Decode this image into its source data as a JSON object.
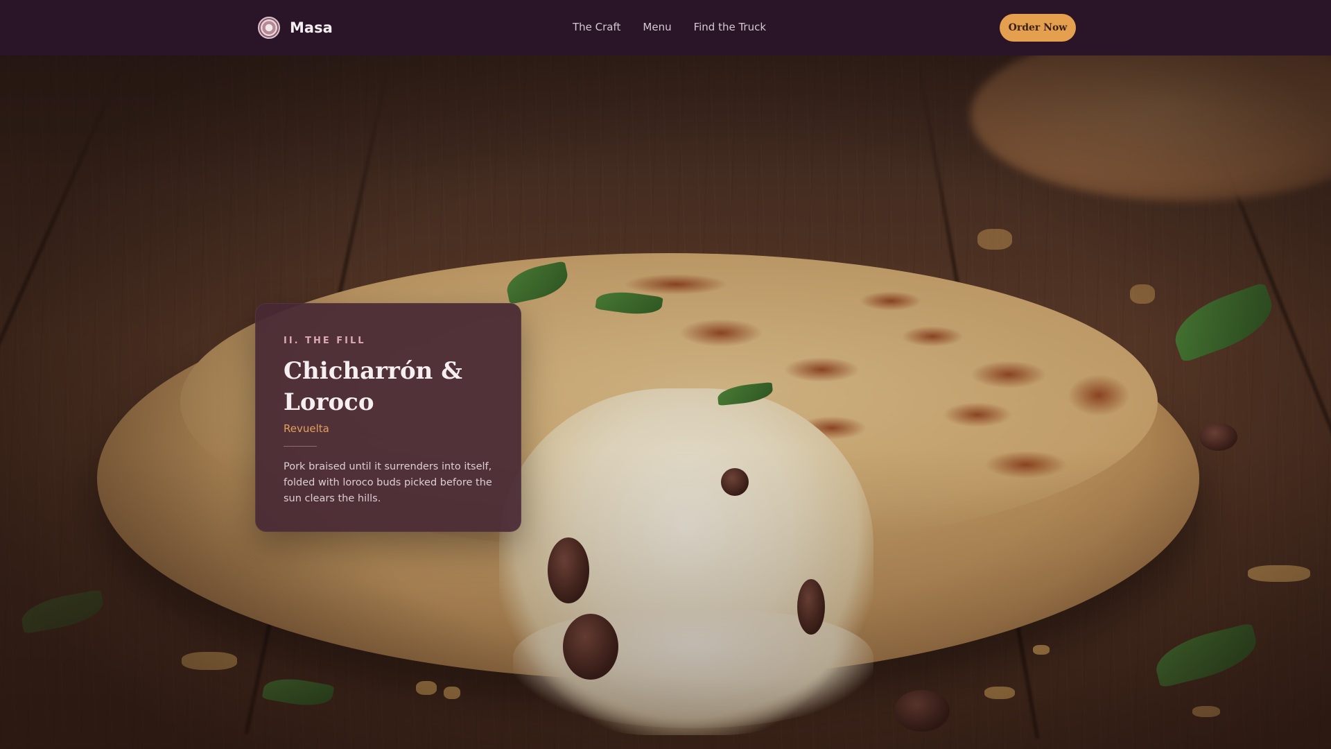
{
  "nav": {
    "brand": "Masa",
    "links": [
      "The Craft",
      "Menu",
      "Find the Truck"
    ],
    "cta": "Order Now"
  },
  "feature": {
    "eyebrow": "II. THE FILL",
    "title": "Chicharrón & Loroco",
    "subtitle": "Revuelta",
    "description": "Pork braised until it surrenders into itself, folded with loroco buds picked before the sun clears the hills."
  },
  "colors": {
    "nav_bg": "#2a1428",
    "accent": "#e4a04f",
    "card_bg": "#482834",
    "eyebrow": "#dcaab7",
    "subtitle": "#e2a15a"
  },
  "icons": {
    "logo": "masa-logo-icon"
  }
}
